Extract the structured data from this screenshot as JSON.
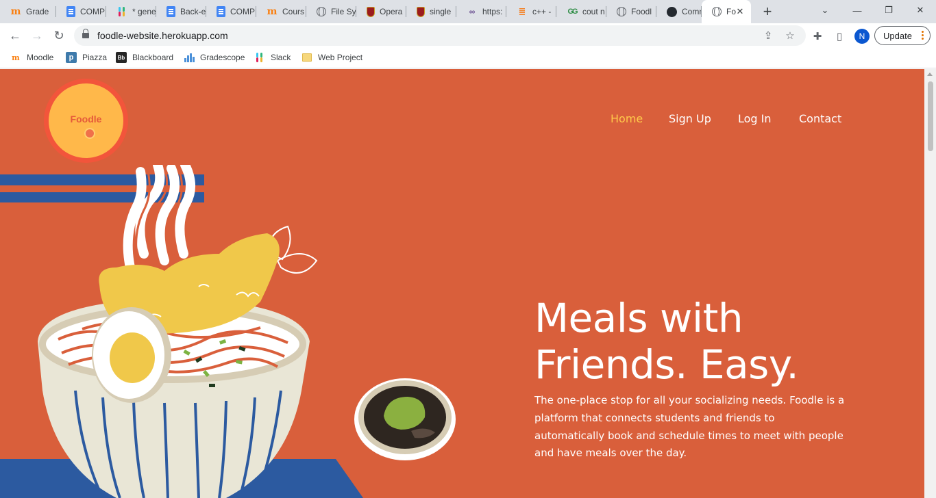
{
  "browser": {
    "tabs": [
      {
        "icon": "moodle-icon",
        "title": "Grade"
      },
      {
        "icon": "docs-icon",
        "title": "COMP"
      },
      {
        "icon": "slack-icon",
        "title": "* gene"
      },
      {
        "icon": "docs-icon",
        "title": "Back-e"
      },
      {
        "icon": "docs-icon",
        "title": "COMP"
      },
      {
        "icon": "moodle-icon",
        "title": "Cours"
      },
      {
        "icon": "globe-icon",
        "title": "File Sy"
      },
      {
        "icon": "crest-icon",
        "title": "Opera"
      },
      {
        "icon": "crest-icon",
        "title": "single"
      },
      {
        "icon": "link-icon",
        "title": "https:"
      },
      {
        "icon": "stackoverflow-icon",
        "title": "c++ -"
      },
      {
        "icon": "geeksforgeeks-icon",
        "title": "cout n"
      },
      {
        "icon": "globe-icon",
        "title": "Foodl"
      },
      {
        "icon": "github-icon",
        "title": "Comn"
      },
      {
        "icon": "globe-icon",
        "title": "Fo"
      }
    ],
    "new_tab": "+",
    "url": "foodle-website.herokuapp.com",
    "profile_initial": "N",
    "update_label": "Update",
    "bookmarks": [
      {
        "icon": "moodle-icon",
        "label": "Moodle"
      },
      {
        "icon": "piazza-icon",
        "label": "Piazza"
      },
      {
        "icon": "blackboard-icon",
        "label": "Blackboard"
      },
      {
        "icon": "gradescope-icon",
        "label": "Gradescope"
      },
      {
        "icon": "slack-icon",
        "label": "Slack"
      },
      {
        "icon": "folder-icon",
        "label": "Web Project"
      }
    ]
  },
  "site": {
    "logo_text": "Foodle",
    "nav": [
      {
        "label": "Home",
        "current": true
      },
      {
        "label": "Sign Up",
        "current": false
      },
      {
        "label": "Log In",
        "current": false
      },
      {
        "label": "Contact",
        "current": false
      }
    ],
    "headline_line1": "Meals with",
    "headline_line2": "Friends. Easy.",
    "description": "The one-place stop for all your socializing needs. Foodle is a platform that connects students and friends to automatically book and schedule times to meet with people and have meals over the day.",
    "colors": {
      "hero_background": "#d95f3b",
      "nav_active": "#ffc94a",
      "logo_fill": "#ffb84a",
      "logo_ring": "#f2553b"
    }
  }
}
